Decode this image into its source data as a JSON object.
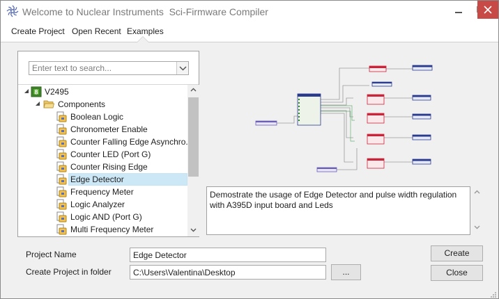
{
  "window": {
    "title": "Welcome to Nuclear Instruments  Sci-Firmware Compiler"
  },
  "tabs": [
    {
      "label": "Create Project"
    },
    {
      "label": "Open Recent"
    },
    {
      "label": "Examples",
      "selected": true
    }
  ],
  "search": {
    "placeholder": "Enter text to search..."
  },
  "tree": {
    "root": {
      "label": "V2495",
      "badge": "8"
    },
    "folder": {
      "label": "Components"
    },
    "items": [
      {
        "label": "Boolean Logic"
      },
      {
        "label": "Chronometer Enable"
      },
      {
        "label": "Counter Falling Edge Asynchro..."
      },
      {
        "label": "Counter LED (Port G)"
      },
      {
        "label": "Counter Rising Edge"
      },
      {
        "label": "Edge Detector",
        "selected": true
      },
      {
        "label": "Frequency Meter"
      },
      {
        "label": "Logic Analyzer"
      },
      {
        "label": "Logic AND (Port G)"
      },
      {
        "label": "Multi Frequency Meter"
      }
    ]
  },
  "description": {
    "text": "Demostrate the usage of Edge Detector and pulse width regulation with A395D input board and Leds"
  },
  "form": {
    "project_name_label": "Project Name",
    "project_name_value": "Edge Detector",
    "folder_label": "Create Project in folder",
    "folder_value": "C:\\Users\\Valentina\\Desktop",
    "browse_label": "...",
    "create_label": "Create",
    "close_label": "Close"
  },
  "colors": {
    "accent_selected": "#cce8f7",
    "close_button": "#c74a46",
    "block_red": "#c8243a",
    "block_blue": "#2a3a8c",
    "block_purple": "#6a5fb5"
  }
}
